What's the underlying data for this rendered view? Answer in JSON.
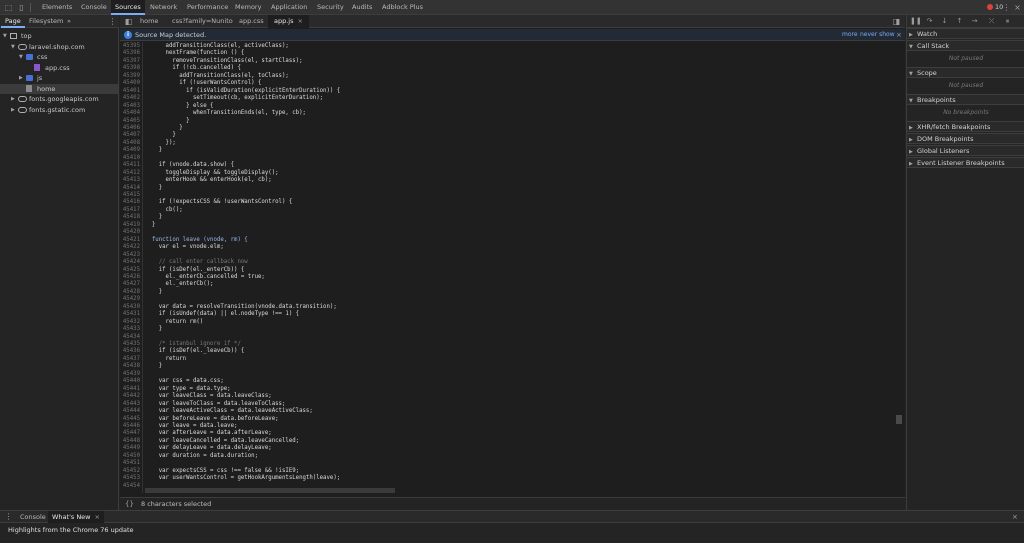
{
  "toolbar": {
    "tabs": [
      "Elements",
      "Console",
      "Sources",
      "Network",
      "Performance",
      "Memory",
      "Application",
      "Security",
      "Audits",
      "Adblock Plus"
    ],
    "active_tab": "Sources",
    "error_count": "10"
  },
  "navigator": {
    "tabs": [
      "Page",
      "Filesystem"
    ],
    "more": "»",
    "tree": [
      {
        "label": "top",
        "type": "frame",
        "depth": 0,
        "arrow": "▼",
        "selected": false
      },
      {
        "label": "laravel.shop.com",
        "type": "cloud",
        "depth": 1,
        "arrow": "▼",
        "selected": false
      },
      {
        "label": "css",
        "type": "folder",
        "depth": 2,
        "arrow": "▼",
        "selected": false
      },
      {
        "label": "app.css",
        "type": "file-purple",
        "depth": 3,
        "arrow": "",
        "selected": false
      },
      {
        "label": "js",
        "type": "folder",
        "depth": 2,
        "arrow": "▶",
        "selected": false
      },
      {
        "label": "home",
        "type": "file-gray",
        "depth": 2,
        "arrow": "",
        "selected": true
      },
      {
        "label": "fonts.googleapis.com",
        "type": "cloud",
        "depth": 1,
        "arrow": "▶",
        "selected": false
      },
      {
        "label": "fonts.gstatic.com",
        "type": "cloud",
        "depth": 1,
        "arrow": "▶",
        "selected": false
      }
    ]
  },
  "editor": {
    "tabs": [
      "home",
      "css?family=Nunito",
      "app.css",
      "app.js"
    ],
    "active_tab": "app.js",
    "close_glyph": "×",
    "infobar": {
      "text": "Source Map detected.",
      "more": "more",
      "never_show": "never show",
      "close": "×"
    },
    "lines": [
      {
        "n": "45395",
        "code": "      addTransitionClass(el, activeClass);",
        "c": "#dcdcdc"
      },
      {
        "n": "45396",
        "code": "      nextFrame(function () {",
        "c": "#dcdcdc"
      },
      {
        "n": "45397",
        "code": "        removeTransitionClass(el, startClass);",
        "c": "#dcdcdc"
      },
      {
        "n": "45398",
        "code": "        if (!cb.cancelled) {",
        "c": "#dcdcdc"
      },
      {
        "n": "45399",
        "code": "          addTransitionClass(el, toClass);",
        "c": "#dcdcdc"
      },
      {
        "n": "45400",
        "code": "          if (!userWantsControl) {",
        "c": "#dcdcdc"
      },
      {
        "n": "45401",
        "code": "            if (isValidDuration(explicitEnterDuration)) {",
        "c": "#dcdcdc"
      },
      {
        "n": "45402",
        "code": "              setTimeout(cb, explicitEnterDuration);",
        "c": "#dcdcdc"
      },
      {
        "n": "45403",
        "code": "            } else {",
        "c": "#dcdcdc"
      },
      {
        "n": "45404",
        "code": "              whenTransitionEnds(el, type, cb);",
        "c": "#dcdcdc"
      },
      {
        "n": "45405",
        "code": "            }",
        "c": "#dcdcdc"
      },
      {
        "n": "45406",
        "code": "          }",
        "c": "#dcdcdc"
      },
      {
        "n": "45407",
        "code": "        }",
        "c": "#dcdcdc"
      },
      {
        "n": "45408",
        "code": "      });",
        "c": "#dcdcdc"
      },
      {
        "n": "45409",
        "code": "    }",
        "c": "#dcdcdc"
      },
      {
        "n": "45410",
        "code": "",
        "c": "#dcdcdc"
      },
      {
        "n": "45411",
        "code": "    if (vnode.data.show) {",
        "c": "#dcdcdc"
      },
      {
        "n": "45412",
        "code": "      toggleDisplay && toggleDisplay();",
        "c": "#dcdcdc"
      },
      {
        "n": "45413",
        "code": "      enterHook && enterHook(el, cb);",
        "c": "#dcdcdc"
      },
      {
        "n": "45414",
        "code": "    }",
        "c": "#dcdcdc"
      },
      {
        "n": "45415",
        "code": "",
        "c": "#dcdcdc"
      },
      {
        "n": "45416",
        "code": "    if (!expectsCSS && !userWantsControl) {",
        "c": "#dcdcdc"
      },
      {
        "n": "45417",
        "code": "      cb();",
        "c": "#dcdcdc"
      },
      {
        "n": "45418",
        "code": "    }",
        "c": "#dcdcdc"
      },
      {
        "n": "45419",
        "code": "  }",
        "c": "#dcdcdc"
      },
      {
        "n": "45420",
        "code": "",
        "c": "#dcdcdc"
      },
      {
        "n": "45421",
        "code": "  function leave (vnode, rm) {",
        "c": "#9ab8f0"
      },
      {
        "n": "45422",
        "code": "    var el = vnode.elm;",
        "c": "#dcdcdc"
      },
      {
        "n": "45423",
        "code": "",
        "c": "#dcdcdc"
      },
      {
        "n": "45424",
        "code": "    // call enter callback now",
        "c": "#777777"
      },
      {
        "n": "45425",
        "code": "    if (isDef(el._enterCb)) {",
        "c": "#dcdcdc"
      },
      {
        "n": "45426",
        "code": "      el._enterCb.cancelled = true;",
        "c": "#dcdcdc"
      },
      {
        "n": "45427",
        "code": "      el._enterCb();",
        "c": "#dcdcdc"
      },
      {
        "n": "45428",
        "code": "    }",
        "c": "#dcdcdc"
      },
      {
        "n": "45429",
        "code": "",
        "c": "#dcdcdc"
      },
      {
        "n": "45430",
        "code": "    var data = resolveTransition(vnode.data.transition);",
        "c": "#dcdcdc"
      },
      {
        "n": "45431",
        "code": "    if (isUndef(data) || el.nodeType !== 1) {",
        "c": "#dcdcdc"
      },
      {
        "n": "45432",
        "code": "      return rm()",
        "c": "#dcdcdc"
      },
      {
        "n": "45433",
        "code": "    }",
        "c": "#dcdcdc"
      },
      {
        "n": "45434",
        "code": "",
        "c": "#dcdcdc"
      },
      {
        "n": "45435",
        "code": "    /* istanbul ignore if */",
        "c": "#777777"
      },
      {
        "n": "45436",
        "code": "    if (isDef(el._leaveCb)) {",
        "c": "#dcdcdc"
      },
      {
        "n": "45437",
        "code": "      return",
        "c": "#dcdcdc"
      },
      {
        "n": "45438",
        "code": "    }",
        "c": "#dcdcdc"
      },
      {
        "n": "45439",
        "code": "",
        "c": "#dcdcdc"
      },
      {
        "n": "45440",
        "code": "    var css = data.css;",
        "c": "#dcdcdc"
      },
      {
        "n": "45441",
        "code": "    var type = data.type;",
        "c": "#dcdcdc"
      },
      {
        "n": "45442",
        "code": "    var leaveClass = data.leaveClass;",
        "c": "#dcdcdc"
      },
      {
        "n": "45443",
        "code": "    var leaveToClass = data.leaveToClass;",
        "c": "#dcdcdc"
      },
      {
        "n": "45444",
        "code": "    var leaveActiveClass = data.leaveActiveClass;",
        "c": "#dcdcdc"
      },
      {
        "n": "45445",
        "code": "    var beforeLeave = data.beforeLeave;",
        "c": "#dcdcdc"
      },
      {
        "n": "45446",
        "code": "    var leave = data.leave;",
        "c": "#dcdcdc"
      },
      {
        "n": "45447",
        "code": "    var afterLeave = data.afterLeave;",
        "c": "#dcdcdc"
      },
      {
        "n": "45448",
        "code": "    var leaveCancelled = data.leaveCancelled;",
        "c": "#dcdcdc"
      },
      {
        "n": "45449",
        "code": "    var delayLeave = data.delayLeave;",
        "c": "#dcdcdc"
      },
      {
        "n": "45450",
        "code": "    var duration = data.duration;",
        "c": "#dcdcdc"
      },
      {
        "n": "45451",
        "code": "",
        "c": "#dcdcdc"
      },
      {
        "n": "45452",
        "code": "    var expectsCSS = css !== false && !isIE9;",
        "c": "#dcdcdc"
      },
      {
        "n": "45453",
        "code": "    var userWantsControl = getHookArgumentsLength(leave);",
        "c": "#dcdcdc"
      },
      {
        "n": "45454",
        "code": "",
        "c": "#dcdcdc"
      }
    ],
    "status": "8 characters selected",
    "format_button": "{}"
  },
  "debugger": {
    "sections": [
      {
        "label": "Watch",
        "empty": ""
      },
      {
        "label": "Call Stack",
        "empty": "Not paused"
      },
      {
        "label": "Scope",
        "empty": "Not paused"
      },
      {
        "label": "Breakpoints",
        "empty": "No breakpoints"
      },
      {
        "label": "XHR/fetch Breakpoints",
        "empty": ""
      },
      {
        "label": "DOM Breakpoints",
        "empty": ""
      },
      {
        "label": "Global Listeners",
        "empty": ""
      },
      {
        "label": "Event Listener Breakpoints",
        "empty": ""
      }
    ]
  },
  "drawer": {
    "tabs": [
      "Console",
      "What's New"
    ],
    "active_tab": "What's New",
    "close": "×",
    "headline": "Highlights from the Chrome 76 update"
  }
}
